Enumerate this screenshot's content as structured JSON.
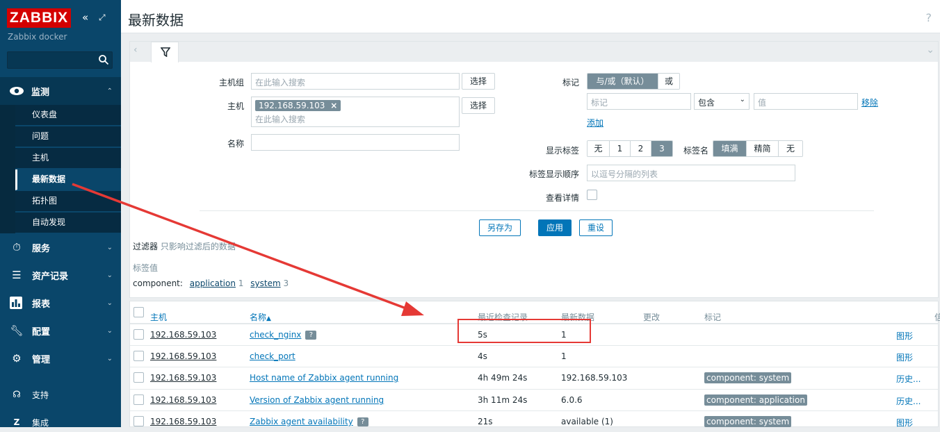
{
  "sidebar": {
    "logo": "ZABBIX",
    "subtitle": "Zabbix docker",
    "monitor": {
      "label": "监测",
      "items": [
        "仪表盘",
        "问题",
        "主机",
        "最新数据",
        "拓扑图",
        "自动发现"
      ]
    },
    "menu": [
      "服务",
      "资产记录",
      "报表",
      "配置",
      "管理"
    ],
    "bottom": [
      "支持",
      "集成"
    ]
  },
  "header": {
    "title": "最新数据",
    "help": "?"
  },
  "filter": {
    "hostgroup": {
      "label": "主机组",
      "placeholder": "在此输入搜索",
      "select": "选择"
    },
    "host": {
      "label": "主机",
      "chip": "192.168.59.103",
      "placeholder": "在此输入搜索",
      "select": "选择"
    },
    "name": {
      "label": "名称"
    },
    "tags": {
      "label": "标记",
      "and_or": "与/或（默认）",
      "or": "或",
      "tag_placeholder": "标记",
      "operator": "包含",
      "value_placeholder": "值",
      "remove": "移除",
      "add": "添加"
    },
    "show_tags": {
      "label": "显示标签",
      "options": [
        "无",
        "1",
        "2",
        "3"
      ],
      "selected": "3"
    },
    "tag_name": {
      "label": "标签名",
      "options": [
        "填满",
        "精简",
        "无"
      ],
      "selected": "填满"
    },
    "tag_order": {
      "label": "标签显示顺序",
      "placeholder": "以逗号分隔的列表"
    },
    "details": {
      "label": "查看详情"
    },
    "buttons": {
      "save_as": "另存为",
      "apply": "应用",
      "reset": "重设"
    }
  },
  "filter_note": {
    "title": "过滤器",
    "text": "只影响过滤后的数据"
  },
  "tag_values": {
    "title": "标签值",
    "key": "component:",
    "items": [
      {
        "name": "application",
        "count": "1"
      },
      {
        "name": "system",
        "count": "3"
      }
    ]
  },
  "table": {
    "headers": [
      "主机",
      "名称",
      "最近检查记录",
      "最新数据",
      "更改",
      "标记",
      "信"
    ],
    "rows": [
      {
        "host": "192.168.59.103",
        "name": "check_nginx",
        "help": "?",
        "last_check": "5s",
        "last_value": "1",
        "tag": "",
        "action": "图形"
      },
      {
        "host": "192.168.59.103",
        "name": "check_port",
        "help": "",
        "last_check": "4s",
        "last_value": "1",
        "tag": "",
        "action": "图形"
      },
      {
        "host": "192.168.59.103",
        "name": "Host name of Zabbix agent running",
        "help": "",
        "last_check": "4h 49m 24s",
        "last_value": "192.168.59.103",
        "tag": "component: system",
        "action": "历史..."
      },
      {
        "host": "192.168.59.103",
        "name": "Version of Zabbix agent running",
        "help": "",
        "last_check": "3h 11m 24s",
        "last_value": "6.0.6",
        "tag": "component: application",
        "action": "历史..."
      },
      {
        "host": "192.168.59.103",
        "name": "Zabbix agent availability",
        "help": "?",
        "last_check": "21s",
        "last_value": "available (1)",
        "tag": "component: system",
        "action": "图形"
      }
    ]
  },
  "colors": {
    "sidebar": "#0a466a",
    "accent": "#0275b8",
    "annotation": "#e53935",
    "chip": "#768d99"
  }
}
